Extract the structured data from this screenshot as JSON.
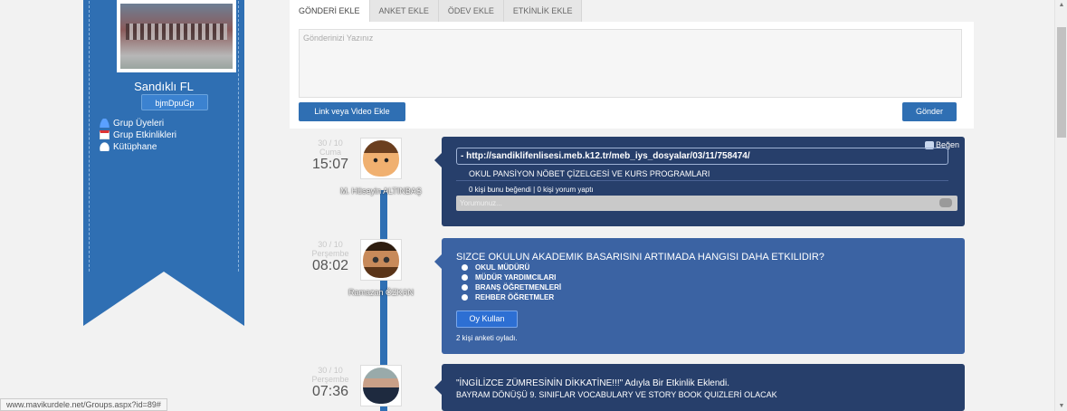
{
  "sidebar": {
    "school_name": "Sandıklı FL",
    "group_code": "bjmDpuGp",
    "links": [
      "Grup Üyeleri",
      "Grup Etkinlikleri",
      "Kütüphane"
    ]
  },
  "composer": {
    "tabs": [
      "GÖNDERİ EKLE",
      "ANKET EKLE",
      "ÖDEV EKLE",
      "ETKİNLİK EKLE"
    ],
    "placeholder": "Gönderinizi Yazınız",
    "link_button": "Link veya Video Ekle",
    "send_button": "Gönder"
  },
  "feed": [
    {
      "date": "30 / 10",
      "day": "Cuma",
      "time": "15:07",
      "author": "M. Hüseyin ALTINBAŞ",
      "like_label": "Beğen",
      "link_url": "- http://sandiklifenlisesi.meb.k12.tr/meb_iys_dosyalar/03/11/758474/",
      "link_title": "OKUL PANSİYON NÖBET ÇİZELGESİ VE KURS PROGRAMLARI",
      "stats": "0 kişi bunu beğendi | 0 kişi yorum yaptı",
      "comment_placeholder": "Yorumunuz..."
    },
    {
      "date": "30 / 10",
      "day": "Perşembe",
      "time": "08:02",
      "author": "Ramazan ÖZKAN",
      "question": "SIZCE OKULUN AKADEMIK BASARISINI ARTIMADA HANGISI DAHA ETKILIDIR?",
      "options": [
        "OKUL MÜDÜRÜ",
        "MÜDÜR YARDIMCILARI",
        "BRANŞ ÖĞRETMENLERİ",
        "REHBER ÖĞRETMLER"
      ],
      "vote_button": "Oy Kullan",
      "vote_count": "2 kişi anketi oyladı."
    },
    {
      "date": "30 / 10",
      "day": "Perşembe",
      "time": "07:36",
      "event_title": "\"İNGİLİZCE ZÜMRESİNİN DİKKATİNE!!!\" Adıyla Bir Etkinlik Eklendi.",
      "event_text": "BAYRAM DÖNÜŞÜ 9. SINIFLAR VOCABULARY VE STORY BOOK QUIZLERİ OLACAK"
    }
  ],
  "status_url": "www.mavikurdele.net/Groups.aspx?id=89#",
  "icons": [
    "users-icon",
    "calendar-icon",
    "cloud-icon",
    "thumbs-up-icon",
    "comment-icon"
  ],
  "colors": {
    "brand_blue": "#2f6fb3",
    "card_dark": "#273f6b",
    "card_light": "#3b63a3"
  }
}
